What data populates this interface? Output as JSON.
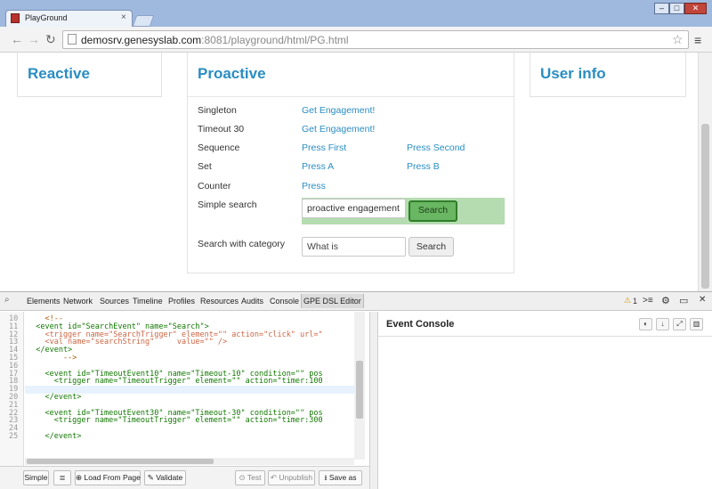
{
  "browser": {
    "tab_title": "PlayGround",
    "tab_close": "×",
    "url_host": "demosrv.genesyslab.com",
    "url_path": ":8081/playground/html/PG.html",
    "win_min": "–",
    "win_max": "□",
    "win_close": "✕"
  },
  "page": {
    "reactive_title": "Reactive",
    "proactive_title": "Proactive",
    "user_info_title": "User info",
    "rows": {
      "singleton": {
        "label": "Singleton",
        "link": "Get Engagement!"
      },
      "timeout30": {
        "label": "Timeout 30",
        "link": "Get Engagement!"
      },
      "sequence": {
        "label": "Sequence",
        "link1": "Press First",
        "link2": "Press Second"
      },
      "set": {
        "label": "Set",
        "link1": "Press A",
        "link2": "Press B"
      },
      "counter": {
        "label": "Counter",
        "link": "Press"
      },
      "simple_search": {
        "label": "Simple search",
        "value": "proactive engagement",
        "button": "Search"
      },
      "search_category": {
        "label": "Search with category",
        "placeholder": "What is",
        "button": "Search"
      }
    }
  },
  "devtools": {
    "tabs": [
      "Elements",
      "Network",
      "Sources",
      "Timeline",
      "Profiles",
      "Resources",
      "Audits",
      "Console",
      "GPE DSL Editor"
    ],
    "warning_count": "1",
    "editor_lines": [
      {
        "n": "10",
        "text": "    <!--"
      },
      {
        "n": "11",
        "text": "  <event id=\"SearchEvent\" name=\"Search\">"
      },
      {
        "n": "12",
        "text": "    <trigger name=\"SearchTrigger\" element=\"\" action=\"click\" url=\""
      },
      {
        "n": "13",
        "text": "    <val name=\"searchString\"     value=\"\" />"
      },
      {
        "n": "14",
        "text": "  </event>"
      },
      {
        "n": "15",
        "text": "        -->"
      },
      {
        "n": "16",
        "text": ""
      },
      {
        "n": "17",
        "text": "    <event id=\"TimeoutEvent10\" name=\"Timeout-10\" condition=\"\" pos"
      },
      {
        "n": "18",
        "text": "      <trigger name=\"TimeoutTrigger\" element=\"\" action=\"timer:100"
      },
      {
        "n": "19",
        "text": ""
      },
      {
        "n": "20",
        "text": "    </event>"
      },
      {
        "n": "21",
        "text": ""
      },
      {
        "n": "22",
        "text": "    <event id=\"TimeoutEvent30\" name=\"Timeout-30\" condition=\"\" pos"
      },
      {
        "n": "23",
        "text": "      <trigger name=\"TimeoutTrigger\" element=\"\" action=\"timer:300"
      },
      {
        "n": "24",
        "text": ""
      },
      {
        "n": "25",
        "text": "    </event>"
      }
    ],
    "buttons": {
      "simple": "Simple",
      "load": "Load From Page",
      "validate": "Validate",
      "test": "Test",
      "unpublish": "Unpublish",
      "save_as": "Save as"
    },
    "console_title": "Event Console"
  }
}
